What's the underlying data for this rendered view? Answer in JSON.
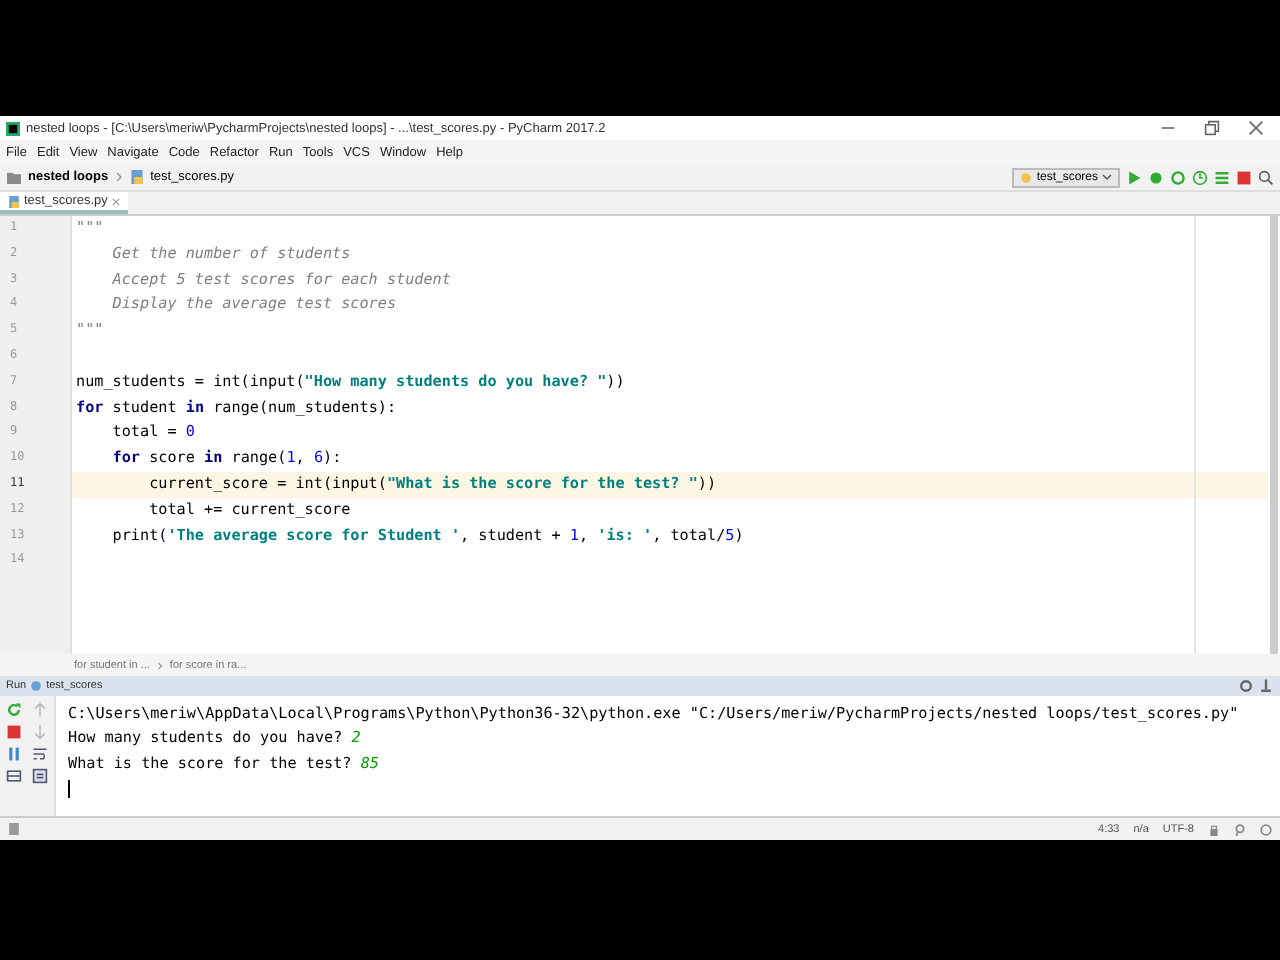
{
  "window": {
    "title": "nested loops - [C:\\Users\\meriw\\PycharmProjects\\nested loops] - ...\\test_scores.py - PyCharm 2017.2"
  },
  "menu": [
    "File",
    "Edit",
    "View",
    "Navigate",
    "Code",
    "Refactor",
    "Run",
    "Tools",
    "VCS",
    "Window",
    "Help"
  ],
  "navigation": {
    "project": "nested loops",
    "file": "test_scores.py",
    "run_config": "test_scores"
  },
  "tabs": [
    {
      "label": "test_scores.py",
      "selected": true
    }
  ],
  "editor": {
    "lines": [
      {
        "number": "1",
        "highlighted": false,
        "tokens": [
          {
            "kind": "comment",
            "text": "\"\"\""
          }
        ]
      },
      {
        "number": "2",
        "highlighted": false,
        "tokens": [
          {
            "kind": "comment",
            "text": "    Get the number of students"
          }
        ]
      },
      {
        "number": "3",
        "highlighted": false,
        "tokens": [
          {
            "kind": "comment",
            "text": "    Accept 5 test scores for each student"
          }
        ]
      },
      {
        "number": "4",
        "highlighted": false,
        "tokens": [
          {
            "kind": "comment",
            "text": "    Display the average test scores"
          }
        ]
      },
      {
        "number": "5",
        "highlighted": false,
        "tokens": [
          {
            "kind": "comment",
            "text": "\"\"\""
          }
        ]
      },
      {
        "number": "6",
        "highlighted": false
      },
      {
        "number": "7",
        "highlighted": false,
        "tokens": [
          {
            "kind": "plain",
            "text": "num_students = int(input("
          },
          {
            "kind": "string",
            "text": "\"How many students do you have? \""
          },
          {
            "kind": "plain",
            "text": "))"
          }
        ]
      },
      {
        "number": "8",
        "highlighted": false,
        "tokens": [
          {
            "kind": "keyword",
            "text": "for"
          },
          {
            "kind": "plain",
            "text": " student "
          },
          {
            "kind": "keyword",
            "text": "in"
          },
          {
            "kind": "plain",
            "text": " range(num_students):"
          }
        ]
      },
      {
        "number": "9",
        "highlighted": false,
        "tokens": [
          {
            "kind": "plain",
            "text": "    total = "
          },
          {
            "kind": "number",
            "text": "0"
          }
        ]
      },
      {
        "number": "10",
        "highlighted": false,
        "tokens": [
          {
            "kind": "keyword",
            "text": "    for"
          },
          {
            "kind": "plain",
            "text": " score "
          },
          {
            "kind": "keyword",
            "text": "in"
          },
          {
            "kind": "plain",
            "text": " range("
          },
          {
            "kind": "number",
            "text": "1"
          },
          {
            "kind": "plain",
            "text": ", "
          },
          {
            "kind": "number",
            "text": "6"
          },
          {
            "kind": "plain",
            "text": "):"
          }
        ]
      },
      {
        "number": "11",
        "highlighted": true,
        "tokens": [
          {
            "kind": "plain",
            "text": "        current_score = int(input("
          },
          {
            "kind": "string",
            "text": "\"What is the score for the test? \""
          },
          {
            "kind": "plain",
            "text": "))"
          }
        ]
      },
      {
        "number": "12",
        "highlighted": false,
        "tokens": [
          {
            "kind": "plain",
            "text": "        total += current_score"
          }
        ]
      },
      {
        "number": "13",
        "highlighted": false,
        "tokens": [
          {
            "kind": "plain",
            "text": "    print("
          },
          {
            "kind": "string",
            "text": "'The average score for Student '"
          },
          {
            "kind": "plain",
            "text": ", student + "
          },
          {
            "kind": "number",
            "text": "1"
          },
          {
            "kind": "plain",
            "text": ", "
          },
          {
            "kind": "string",
            "text": "'is: '"
          },
          {
            "kind": "plain",
            "text": ", total/"
          },
          {
            "kind": "number",
            "text": "5"
          },
          {
            "kind": "plain",
            "text": ")"
          }
        ]
      },
      {
        "number": "14",
        "highlighted": false
      }
    ]
  },
  "breadcrumbs": [
    "for student in ...",
    "for score in ra..."
  ],
  "run_panel": {
    "label": "Run",
    "config": "test_scores",
    "lines": [
      {
        "tokens": [
          {
            "kind": "output",
            "text": "C:\\Users\\meriw\\AppData\\Local\\Programs\\Python\\Python36-32\\python.exe \"C:/Users/meriw/PycharmProjects/nested loops/test_scores.py\""
          }
        ]
      },
      {
        "tokens": [
          {
            "kind": "output",
            "text": "How many students do you have? "
          },
          {
            "kind": "input",
            "text": "2"
          }
        ]
      },
      {
        "tokens": [
          {
            "kind": "output",
            "text": "What is the score for the test? "
          },
          {
            "kind": "input",
            "text": "85"
          }
        ]
      },
      {
        "cursor": true
      }
    ]
  },
  "status_bar": {
    "position": "4:33",
    "line_separator": "n/a",
    "encoding": "UTF-8"
  }
}
